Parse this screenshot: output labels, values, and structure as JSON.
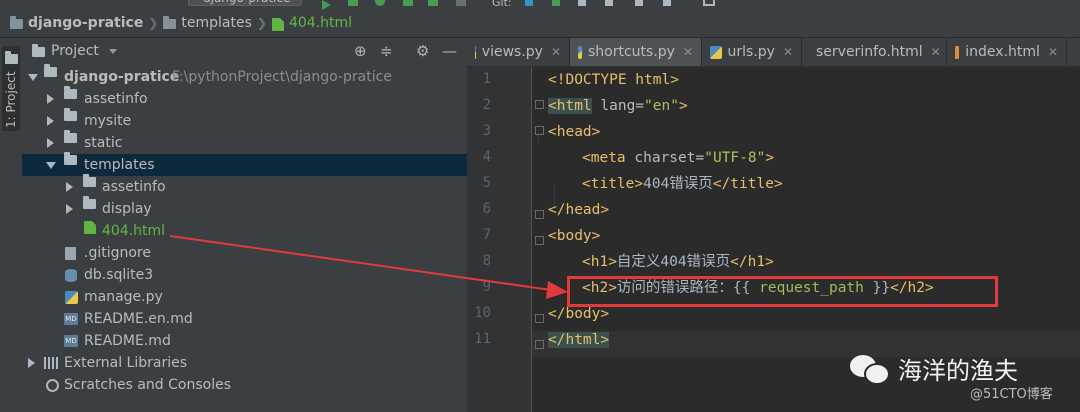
{
  "breadcrumb": [
    "django-pratice",
    "templates",
    "404.html"
  ],
  "run_config": "django-pratice",
  "left_strip": {
    "tab_label": "1: Project"
  },
  "project_panel": {
    "title": "Project",
    "tree": [
      {
        "label": "django-pratice",
        "path": "F:\\pythonProject\\django-pratice",
        "expanded": true
      },
      {
        "label": "assetinfo"
      },
      {
        "label": "mysite"
      },
      {
        "label": "static"
      },
      {
        "label": "templates",
        "expanded": true,
        "selected": true
      },
      {
        "label": "assetinfo"
      },
      {
        "label": "display"
      },
      {
        "label": "404.html"
      },
      {
        "label": ".gitignore"
      },
      {
        "label": "db.sqlite3"
      },
      {
        "label": "manage.py"
      },
      {
        "label": "README.en.md"
      },
      {
        "label": "README.md"
      },
      {
        "label": "External Libraries"
      },
      {
        "label": "Scratches and Consoles"
      }
    ]
  },
  "editor": {
    "tabs": [
      {
        "label": "views.py",
        "type": "py"
      },
      {
        "label": "shortcuts.py",
        "type": "py",
        "active": true
      },
      {
        "label": "urls.py",
        "type": "py"
      },
      {
        "label": "serverinfo.html",
        "type": "html"
      },
      {
        "label": "index.html",
        "type": "html"
      }
    ],
    "line_numbers": [
      "1",
      "2",
      "3",
      "4",
      "5",
      "6",
      "7",
      "8",
      "9",
      "10",
      "11"
    ],
    "lines": [
      {
        "t1": "<!DOCTYPE html>"
      },
      {
        "t1": "<html",
        "a": " lang=",
        "s": "\"en\"",
        "t2": ">"
      },
      {
        "t1": "<head>"
      },
      {
        "t1": "<meta",
        "a": " charset=",
        "s": "\"UTF-8\"",
        "t2": ">"
      },
      {
        "t1": "<title>",
        "x": "404错误页",
        "t2": "</title>"
      },
      {
        "t1": "</head>"
      },
      {
        "t1": "<body>"
      },
      {
        "t1": "<h1>",
        "x": "自定义404错误页",
        "t2": "</h1>"
      },
      {
        "t1": "<h2>",
        "x": "访问的错误路径：{{ ",
        "v": "request_path",
        "y": " }}",
        "t2": "</h2>"
      },
      {
        "t1": "</body>"
      },
      {
        "t1": "</html>"
      }
    ]
  },
  "watermark": {
    "name": "海洋的渔夫",
    "sub": "@51CTO博客"
  },
  "colors": {
    "annotation_red": "#e23a3a",
    "tag": "#e8bf6a",
    "string": "#a5c25c"
  }
}
